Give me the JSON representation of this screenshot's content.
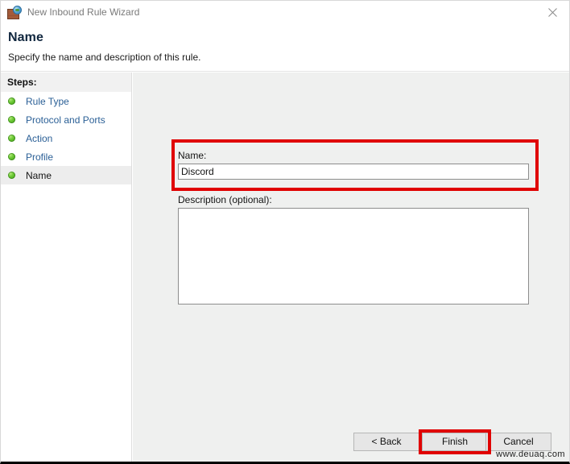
{
  "window": {
    "title": "New Inbound Rule Wizard",
    "icon": "firewall-brick-globe-icon",
    "close_label": "✕"
  },
  "header": {
    "title": "Name",
    "subtitle": "Specify the name and description of this rule."
  },
  "sidebar": {
    "heading": "Steps:",
    "items": [
      {
        "label": "Rule Type",
        "current": false
      },
      {
        "label": "Protocol and Ports",
        "current": false
      },
      {
        "label": "Action",
        "current": false
      },
      {
        "label": "Profile",
        "current": false
      },
      {
        "label": "Name",
        "current": true
      }
    ]
  },
  "form": {
    "name_label": "Name:",
    "name_value": "Discord",
    "name_placeholder": "",
    "description_label": "Description (optional):",
    "description_value": "",
    "description_placeholder": ""
  },
  "footer": {
    "back_label": "< Back",
    "finish_label": "Finish",
    "cancel_label": "Cancel"
  },
  "watermark": {
    "text": "www.deuaq.com"
  },
  "colors": {
    "annotation_red": "#e00000",
    "step_link_blue": "#2a5f96",
    "content_background": "#eff0ef",
    "bullet_green": "#6dc936"
  }
}
